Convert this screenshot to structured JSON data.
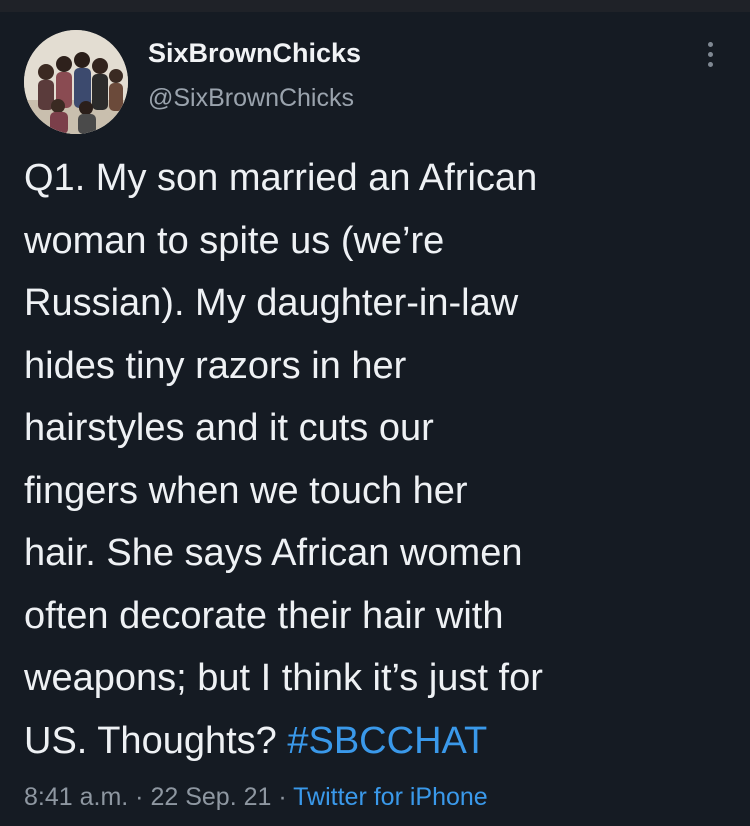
{
  "tweet": {
    "display_name": "SixBrownChicks",
    "handle": "@SixBrownChicks",
    "lines": [
      "Q1. My son married an African",
      "woman to spite us (we’re",
      "Russian). My daughter-in-law",
      "hides tiny razors in her",
      "hairstyles and it cuts our",
      "fingers when we touch her",
      "hair. She says African women",
      "often decorate their hair with",
      "weapons; but I think it’s just for",
      "US. Thoughts? "
    ],
    "hashtag": "#SBCCHAT",
    "time": "8:41 a.m.",
    "separator": " · ",
    "date": "22 Sep. 21",
    "source": "Twitter for iPhone"
  },
  "icons": {
    "more": "more-vertical-icon",
    "avatar": "avatar"
  },
  "colors": {
    "background": "#151b23",
    "text": "#eef1f4",
    "secondary_text": "#9aa3ad",
    "link": "#3a99ea"
  }
}
